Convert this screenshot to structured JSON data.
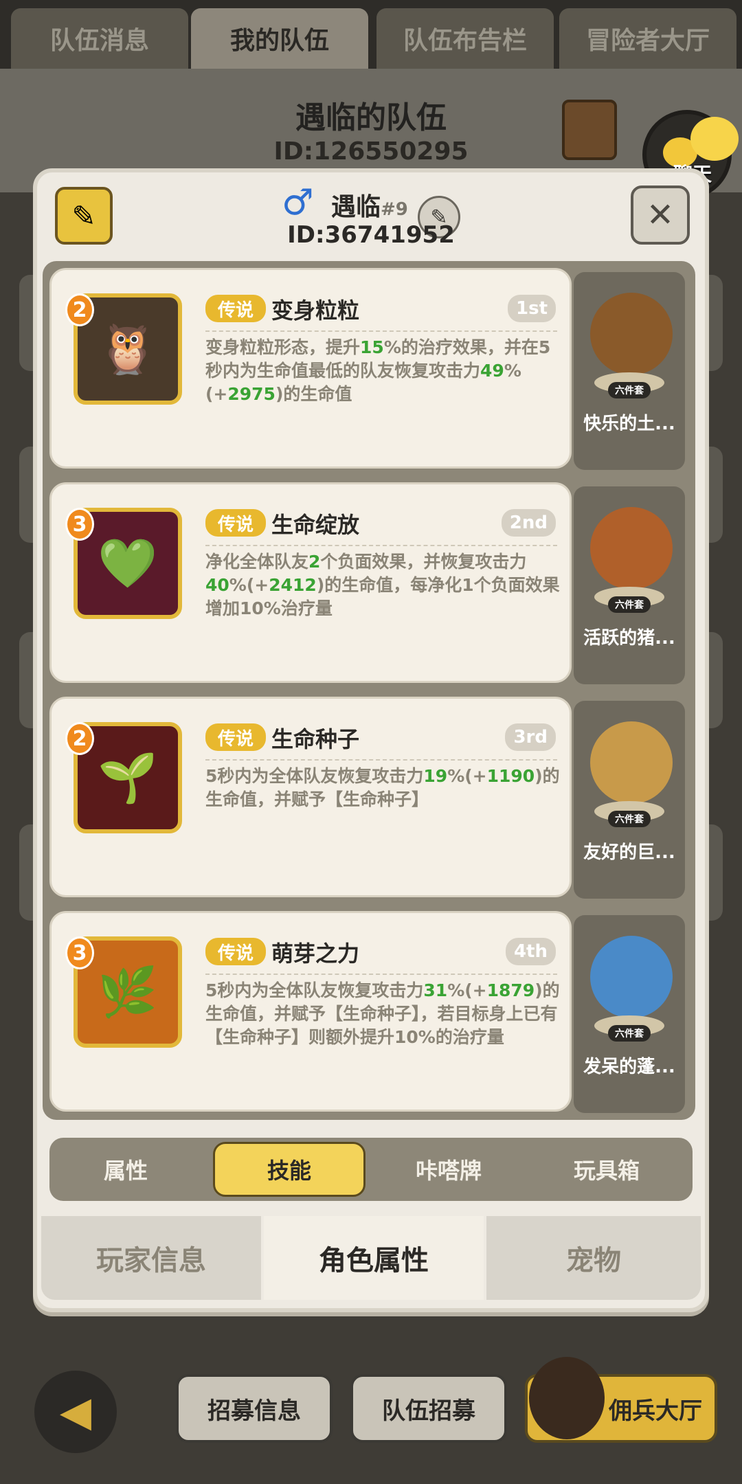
{
  "top_tabs": [
    "队伍消息",
    "我的队伍",
    "队伍布告栏",
    "冒险者大厅"
  ],
  "header": {
    "team_title": "遇临的队伍",
    "team_id": "ID:126550295",
    "chat_label": "聊天"
  },
  "player": {
    "name": "遇临",
    "rank": "#9",
    "id": "ID:36741952",
    "gender_icon": "male-icon"
  },
  "skills": [
    {
      "level": "2",
      "tag": "传说",
      "name": "变身粒粒",
      "order": "1st",
      "desc_parts": [
        "变身粒粒形态，提升",
        "15",
        "%的治疗效果，并在5秒内为生命值最低的队友恢复攻击力",
        "49",
        "%(+",
        "2975",
        ")的生命值"
      ],
      "icon": "owl-icon"
    },
    {
      "level": "3",
      "tag": "传说",
      "name": "生命绽放",
      "order": "2nd",
      "desc_parts": [
        "净化全体队友",
        "2",
        "个负面效果，并恢复攻击力",
        "40",
        "%(+",
        "2412",
        ")的生命值，每净化1个负面效果增加10%治疗量"
      ],
      "icon": "heart-flower-icon"
    },
    {
      "level": "2",
      "tag": "传说",
      "name": "生命种子",
      "order": "3rd",
      "desc_parts": [
        "5秒内为全体队友恢复攻击力",
        "19",
        "%(+",
        "1190",
        ")的生命值，并赋予【生命种子】"
      ],
      "icon": "seed-icon"
    },
    {
      "level": "3",
      "tag": "传说",
      "name": "萌芽之力",
      "order": "4th",
      "desc_parts": [
        "5秒内为全体队友恢复攻击力",
        "31",
        "%(+",
        "1879",
        ")的生命值，并赋予【生命种子】，若目标身上已有【生命种子】则额外提升10%的治疗量"
      ],
      "icon": "sprout-icon"
    }
  ],
  "pets": [
    {
      "name": "快乐的土...",
      "badge": "六件套"
    },
    {
      "name": "活跃的猪...",
      "badge": "六件套"
    },
    {
      "name": "友好的巨...",
      "badge": "六件套"
    },
    {
      "name": "发呆的蓬...",
      "badge": "六件套"
    }
  ],
  "sub_tabs": [
    "属性",
    "技能",
    "咔嗒牌",
    "玩具箱"
  ],
  "modal_tabs": [
    "玩家信息",
    "角色属性",
    "宠物"
  ],
  "footer": {
    "recruit_info": "招募信息",
    "team_recruit": "队伍招募",
    "mercenary_hall": "佣兵大厅"
  }
}
